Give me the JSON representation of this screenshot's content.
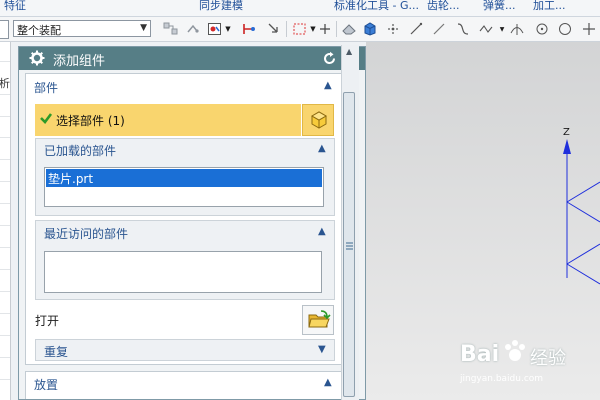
{
  "ribbon": {
    "tabs": [
      "特征",
      "同步建模",
      "标准化工具 - G...",
      "齿轮...",
      "弹簧...",
      "加工..."
    ]
  },
  "toolbar": {
    "assembly_filter": "整个装配"
  },
  "left_panel": {
    "partial_text": "析"
  },
  "dialog": {
    "title": "添加组件",
    "reset_icon": "reset-icon",
    "close_icon": "close-icon",
    "parts_group": {
      "header": "部件",
      "select_label": "选择部件 (1)",
      "loaded_parts": {
        "header": "已加载的部件",
        "items": [
          "垫片.prt"
        ]
      },
      "recent_parts": {
        "header": "最近访问的部件",
        "items": []
      },
      "open_label": "打开",
      "repeat_label": "重复"
    },
    "placement_group": {
      "header": "放置"
    }
  },
  "graphics": {
    "axis_label": "Z",
    "line_color": "#1f2fdc"
  },
  "watermark": {
    "brand_left": "Bai",
    "brand_right": "经验",
    "url": "jingyan.baidu.com"
  },
  "colors": {
    "title_bar": "#567e86",
    "selected_bar": "#f9d56e",
    "selection_row": "#1a6fd6",
    "header_text": "#2a5590"
  }
}
